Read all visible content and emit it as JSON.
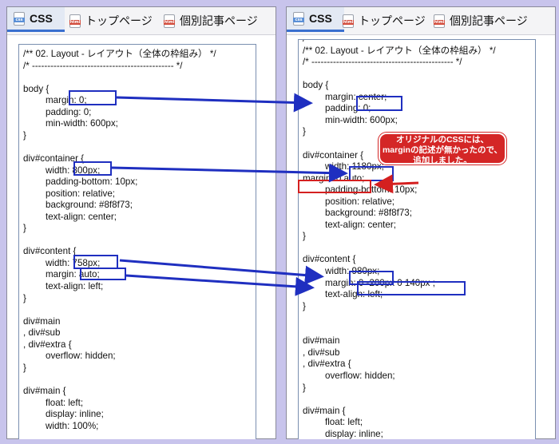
{
  "tabs": {
    "css": "CSS",
    "top_page": "トップページ",
    "single_page": "個別記事ページ",
    "css_icon_text": "css",
    "html_icon_text": "html"
  },
  "left_code": [
    "/** 02. Layout - レイアウト（全体の枠組み） */",
    "/* ---------------------------------------------- */",
    "",
    "body {",
    "margin: 0;",
    "padding: 0;",
    "min-width: 600px;",
    "}",
    "",
    "div#container {",
    "width: 800px;",
    "padding-bottom: 10px;",
    "position: relative;",
    "background: #8f8f73;",
    "text-align: center;",
    "}",
    "",
    "div#content {",
    "width: 758px;",
    "margin: auto;",
    "text-align: left;",
    "}",
    "",
    "div#main",
    ", div#sub",
    ", div#extra {",
    "overflow: hidden;",
    "}",
    "",
    "div#main {",
    "float: left;",
    "display: inline;",
    "width: 100%;"
  ],
  "right_code": [
    "/* ==============================================",
    "/** 02. Layout - レイアウト（全体の枠組み） */",
    "/* ---------------------------------------------- */",
    "",
    "body {",
    "margin: center;",
    "padding: 0;",
    "min-width: 600px;",
    "}",
    "",
    "div#container {",
    "width: 1180px;",
    "margin: 0 auto;",
    "padding-bottom: 10px;",
    "position: relative;",
    "background: #8f8f73;",
    "text-align: center;",
    "}",
    "",
    "div#content {",
    "width: 980px;",
    "margin: 0 -200px 0 140px ;",
    "text-align: left;",
    "}",
    "",
    "",
    "div#main",
    ", div#sub",
    ", div#extra {",
    "overflow: hidden;",
    "}",
    "",
    "div#main {",
    "float: left;",
    "display: inline;"
  ],
  "callout": {
    "line1": "オリジナルのCSSには、",
    "line2": "marginの記述が無かったので、",
    "line3": "追加しました。"
  },
  "colors": {
    "background": "#c8c4ec",
    "highlight_blue": "#1f2fc0",
    "highlight_red": "#d42020",
    "callout_bg": "#d42626"
  }
}
